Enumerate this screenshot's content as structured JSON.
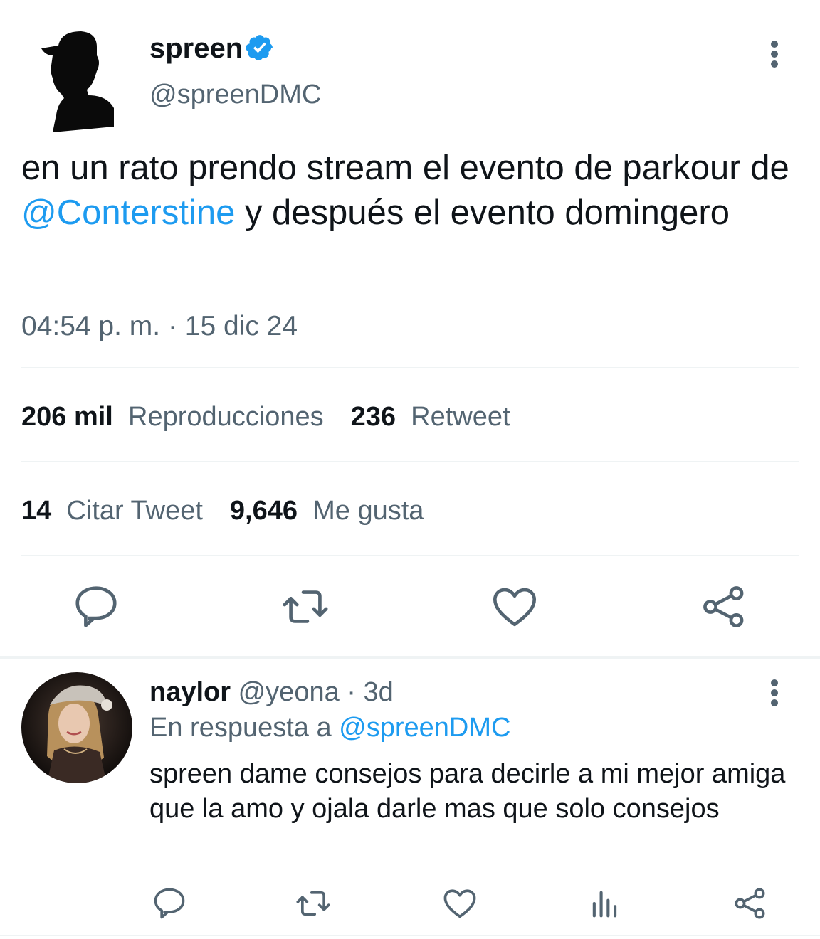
{
  "tweet": {
    "author_name": "spreen",
    "author_handle": "@spreenDMC",
    "text_before": "en un rato prendo stream el evento de parkour de ",
    "mention": "@Conterstine",
    "text_after": " y después el evento domingero",
    "timestamp": "04:54 p. m. · 15 dic 24",
    "stats": {
      "views_count": "206 mil",
      "views_label": "Reproducciones",
      "retweets_count": "236",
      "retweets_label": "Retweet",
      "quotes_count": "14",
      "quotes_label": "Citar Tweet",
      "likes_count": "9,646",
      "likes_label": "Me gusta"
    },
    "actions": [
      "reply-icon",
      "retweet-icon",
      "like-icon",
      "share-icon"
    ]
  },
  "reply": {
    "author_name": "naylor",
    "author_handle": "@yeona",
    "time": "· 3d",
    "reply_to_prefix": "En respuesta a",
    "reply_to_handle": "@spreenDMC",
    "text": "spreen dame consejos para decirle a mi mejor amiga que la amo y ojala darle mas que solo consejos",
    "actions": [
      "reply-icon",
      "retweet-icon",
      "like-icon",
      "analytics-icon",
      "share-icon"
    ]
  },
  "colors": {
    "accent": "#1d9bf0",
    "text_primary": "#0f1419",
    "text_secondary": "#536471",
    "divider": "#eff3f4"
  }
}
